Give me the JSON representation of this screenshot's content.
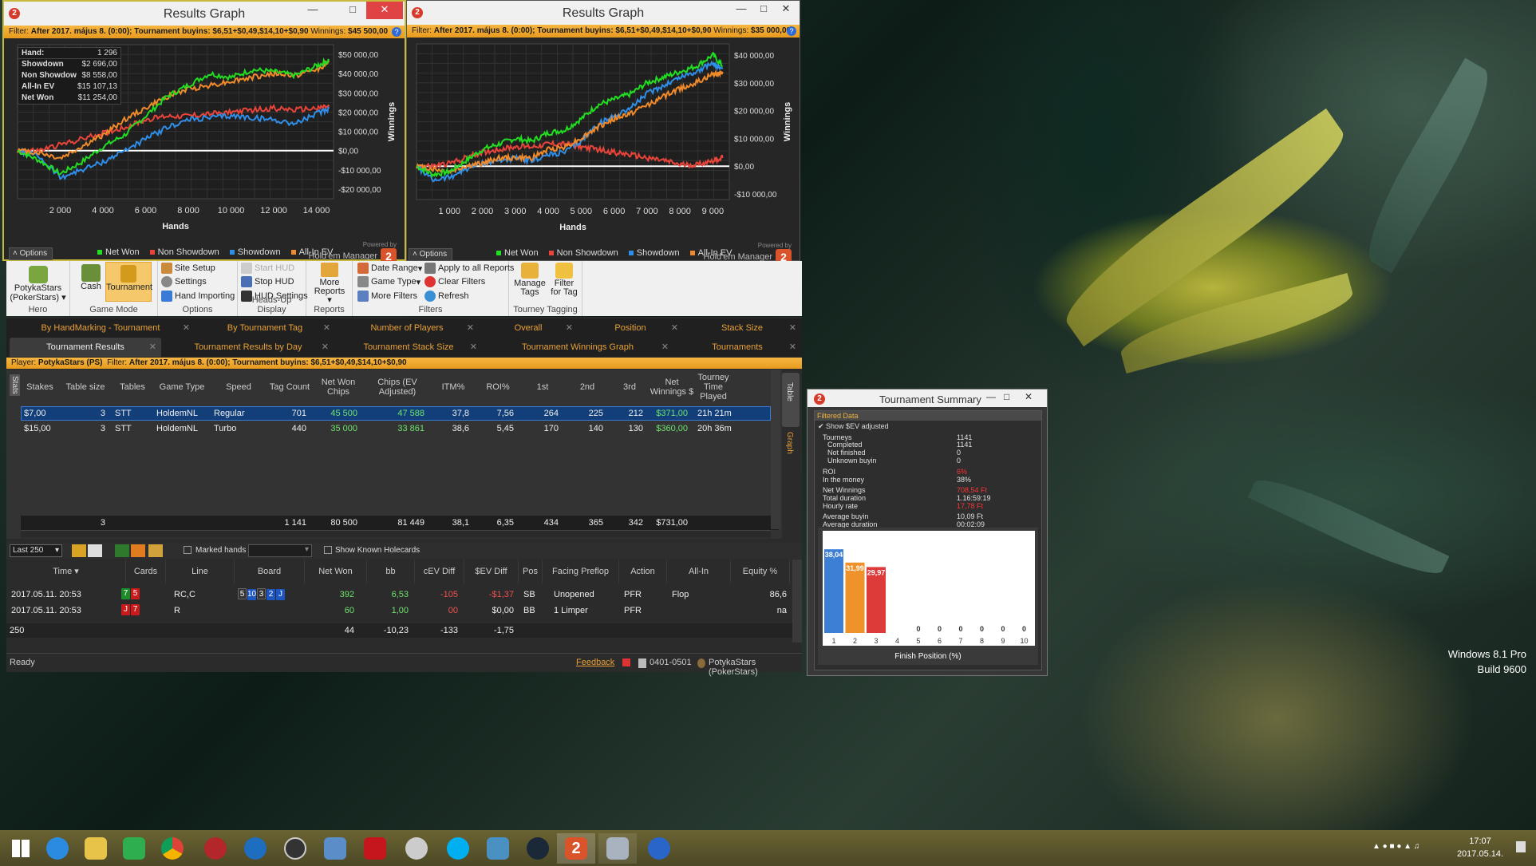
{
  "desktop": {
    "watermark_line1": "Windows 8.1 Pro",
    "watermark_line2": "Build 9600"
  },
  "graph1": {
    "title": "Results Graph",
    "filter_label": "Filter:",
    "filter_text": "After 2017. május 8. (0:00); Tournament buyins: $6,51+$0,49,$14,10+$0,90",
    "winnings_label": "Winnings:",
    "winnings_value": "$45 500,00",
    "stats": [
      {
        "k": "Hand:",
        "v": "1 296"
      },
      {
        "k": "Showdown",
        "v": "$2 696,00"
      },
      {
        "k": "Non Showdow",
        "v": "$8 558,00"
      },
      {
        "k": "All-In EV",
        "v": "$15 107,13"
      },
      {
        "k": "Net Won",
        "v": "$11 254,00"
      }
    ],
    "x_ticks": [
      "2 000",
      "4 000",
      "6 000",
      "8 000",
      "10 000",
      "12 000",
      "14 000"
    ],
    "y_ticks": [
      "$50 000,00",
      "$40 000,00",
      "$30 000,00",
      "$20 000,00",
      "$10 000,00",
      "$0,00",
      "-$10 000,00",
      "-$20 000,00"
    ],
    "xlabel": "Hands",
    "ylabel": "Winnings",
    "options": "Options",
    "legend": [
      "Net Won",
      "Non Showdown",
      "Showdown",
      "All-In EV"
    ],
    "powered": "Powered by",
    "brand": "Hold'em Manager",
    "badge": "2"
  },
  "graph2": {
    "title": "Results Graph",
    "filter_label": "Filter:",
    "filter_text": "After 2017. május 8. (0:00); Tournament buyins: $6,51+$0,49,$14,10+$0,90",
    "winnings_label": "Winnings:",
    "winnings_value": "$35 000,00",
    "x_ticks": [
      "1 000",
      "2 000",
      "3 000",
      "4 000",
      "5 000",
      "6 000",
      "7 000",
      "8 000",
      "9 000"
    ],
    "y_ticks": [
      "$40 000,00",
      "$30 000,00",
      "$20 000,00",
      "$10 000,00",
      "$0,00",
      "-$10 000,00"
    ],
    "xlabel": "Hands",
    "ylabel": "Winnings",
    "options": "Options",
    "legend": [
      "Net Won",
      "Non Showdown",
      "Showdown",
      "All-In EV"
    ],
    "powered": "Powered by",
    "brand": "Hold'em Manager",
    "badge": "2"
  },
  "colors": {
    "net_won": "#22dd22",
    "non_showdown": "#e8443a",
    "showdown": "#2f8ee8",
    "all_in_ev": "#f08a2a",
    "accent": "#e8a037"
  },
  "chart_data": [
    {
      "type": "line",
      "xlabel": "Hands",
      "ylabel": "Winnings",
      "xlim": [
        0,
        14800
      ],
      "ylim": [
        -25000,
        55000
      ],
      "x": [
        0,
        1000,
        2000,
        3000,
        4000,
        5000,
        6000,
        7000,
        8000,
        9000,
        10000,
        11000,
        12000,
        13000,
        14000,
        14600
      ],
      "series": [
        {
          "name": "Net Won",
          "values": [
            0,
            -5000,
            -12000,
            -6000,
            2000,
            8000,
            18000,
            28000,
            34000,
            40000,
            38000,
            42000,
            41000,
            39000,
            44000,
            47000
          ]
        },
        {
          "name": "Non Showdown",
          "values": [
            0,
            0,
            3000,
            6000,
            9000,
            12000,
            16000,
            18000,
            18000,
            19000,
            20000,
            21000,
            22000,
            21000,
            22000,
            23000
          ]
        },
        {
          "name": "Showdown",
          "values": [
            0,
            -3000,
            -14000,
            -10000,
            -6000,
            0,
            6000,
            12000,
            16000,
            17000,
            18000,
            17000,
            16000,
            14000,
            19000,
            22000
          ]
        },
        {
          "name": "All-In EV",
          "values": [
            0,
            -1000,
            -4000,
            2000,
            8000,
            16000,
            22000,
            28000,
            32000,
            34000,
            36000,
            38000,
            40000,
            39000,
            42000,
            46000
          ]
        }
      ]
    },
    {
      "type": "line",
      "xlabel": "Hands",
      "ylabel": "Winnings",
      "xlim": [
        0,
        9500
      ],
      "ylim": [
        -12000,
        44000
      ],
      "x": [
        0,
        500,
        1000,
        1500,
        2000,
        2500,
        3000,
        3500,
        4000,
        4500,
        5000,
        5500,
        6000,
        6500,
        7000,
        7500,
        8000,
        8500,
        9000,
        9300
      ],
      "series": [
        {
          "name": "Net Won",
          "values": [
            0,
            -3000,
            -2000,
            2000,
            6000,
            8000,
            10000,
            9000,
            12000,
            13000,
            17000,
            22000,
            24000,
            26000,
            30000,
            32000,
            34000,
            36000,
            40000,
            36000
          ]
        },
        {
          "name": "Non Showdown",
          "values": [
            0,
            0,
            1000,
            3000,
            5000,
            6000,
            7000,
            7000,
            8000,
            8000,
            7000,
            6000,
            5000,
            4000,
            3000,
            2000,
            500,
            500,
            2000,
            3000
          ]
        },
        {
          "name": "Showdown",
          "values": [
            0,
            -5000,
            -4000,
            -1000,
            1000,
            2000,
            3000,
            2000,
            4000,
            5000,
            9000,
            15000,
            18000,
            21000,
            26000,
            29000,
            32000,
            34000,
            37000,
            35000
          ]
        },
        {
          "name": "All-In EV",
          "values": [
            0,
            -1000,
            -2000,
            0,
            1000,
            3000,
            3000,
            3000,
            6000,
            7000,
            10000,
            14000,
            17000,
            19000,
            22000,
            25000,
            28000,
            30000,
            33000,
            34000
          ]
        }
      ]
    },
    {
      "type": "bar",
      "title": "Finish Position (%)",
      "categories": [
        "1",
        "2",
        "3",
        "4",
        "5",
        "6",
        "7",
        "8",
        "9",
        "10"
      ],
      "values": [
        38.04,
        31.99,
        29.97,
        0,
        0,
        0,
        0,
        0,
        0,
        0
      ],
      "value_labels": [
        "38,04",
        "31,99",
        "29,97",
        "",
        "0",
        "0",
        "0",
        "0",
        "0",
        "0"
      ],
      "ylim": [
        0,
        45
      ]
    }
  ],
  "ribbon": {
    "hero": {
      "name": "PotykaStars",
      "site": "(PokerStars)",
      "label": "Hero"
    },
    "gamemode": {
      "cash": "Cash",
      "tournament": "Tournament",
      "label": "Game Mode"
    },
    "options": {
      "site_setup": "Site Setup",
      "settings": "Settings",
      "hand_importing": "Hand Importing",
      "label": "Options"
    },
    "hud": {
      "start": "Start HUD",
      "stop": "Stop HUD",
      "settings": "HUD Settings",
      "label": "Heads-Up Display"
    },
    "reports": {
      "more": "More",
      "reports": "Reports",
      "label": "Reports"
    },
    "filters": {
      "date_range": "Date Range",
      "game_type": "Game Type",
      "more_filters": "More Filters",
      "apply_all": "Apply to all Reports",
      "clear": "Clear Filters",
      "refresh": "Refresh",
      "label": "Filters"
    },
    "tagging": {
      "manage": "Manage",
      "tags": "Tags",
      "filter": "Filter",
      "for_tag": "for Tag",
      "label": "Tourney Tagging"
    }
  },
  "tabs_row1": [
    "By HandMarking - Tournament",
    "By Tournament Tag",
    "Number of Players",
    "Overall",
    "Position",
    "Stack Size"
  ],
  "tabs_row2": [
    "Tournament Results",
    "Tournament Results by Day",
    "Tournament Stack Size",
    "Tournament Winnings Graph",
    "Tournaments"
  ],
  "player_bar": {
    "player_label": "Player:",
    "player": "PotykaStars (PS)",
    "filter_label": "Filter:",
    "filter": "After 2017. május 8. (0:00); Tournament buyins: $6,51+$0,49,$14,10+$0,90"
  },
  "results": {
    "side_label": "Stats",
    "headers": [
      "Stakes",
      "Table size",
      "Tables",
      "Game Type",
      "Speed",
      "Tag Count",
      "Net Won Chips",
      "Chips (EV Adjusted)",
      "ITM%",
      "ROI%",
      "1st",
      "2nd",
      "3rd",
      "Net Winnings $",
      "Tourney Time Played"
    ],
    "rows": [
      [
        "$7,00",
        "3",
        "STT",
        "HoldemNL",
        "Regular",
        "701",
        "45 500",
        "47 588",
        "37,8",
        "7,56",
        "264",
        "225",
        "212",
        "$371,00",
        "21h 21m"
      ],
      [
        "$15,00",
        "3",
        "STT",
        "HoldemNL",
        "Turbo",
        "440",
        "35 000",
        "33 861",
        "38,6",
        "5,45",
        "170",
        "140",
        "130",
        "$360,00",
        "20h 36m"
      ]
    ],
    "totals": [
      "3",
      "1 141",
      "80 500",
      "81 449",
      "38,1",
      "6,35",
      "434",
      "365",
      "342",
      "$731,00"
    ],
    "side_table": "Table",
    "side_graph": "Graph"
  },
  "handbar": {
    "last": "Last 250",
    "marked": "Marked hands",
    "known": "Show Known Holecards"
  },
  "hands": {
    "headers": [
      "Time",
      "Cards",
      "Line",
      "Board",
      "Net Won",
      "bb",
      "cEV Diff",
      "$EV Diff",
      "Pos",
      "Facing Preflop",
      "Action",
      "All-In",
      "Equity %"
    ],
    "rows": [
      {
        "time": "2017.05.11. 20:53",
        "cards": [
          "7",
          "5"
        ],
        "line": "RC,C",
        "board": [
          "5",
          "10",
          "3",
          "2",
          "J"
        ],
        "net": "392",
        "bb": "6,53",
        "cev": "-105",
        "sev": "-$1,37",
        "pos": "SB",
        "facing": "Unopened",
        "action": "PFR",
        "allin": "Flop",
        "eq": "86,6"
      },
      {
        "time": "2017.05.11. 20:53",
        "cards": [
          "J",
          "7"
        ],
        "line": "R",
        "board": [],
        "net": "60",
        "bb": "1,00",
        "cev": "00",
        "sev": "$0,00",
        "pos": "BB",
        "facing": "1 Limper",
        "action": "PFR",
        "allin": "",
        "eq": "na"
      }
    ],
    "totals": [
      "250",
      "44",
      "-10,23",
      "-133",
      "-1,75"
    ]
  },
  "status": {
    "ready": "Ready",
    "feedback": "Feedback",
    "build": "0401-0501",
    "user": "PotykaStars (PokerStars)"
  },
  "summary": {
    "title": "Tournament Summary",
    "filtered": "Filtered Data",
    "sev": "Show $EV adjusted",
    "rows": [
      {
        "k": "Tourneys",
        "v": "1141"
      },
      {
        "k": "Completed",
        "v": "1141"
      },
      {
        "k": "Not finished",
        "v": "0"
      },
      {
        "k": "Unknown buyin",
        "v": "0"
      },
      {
        "k": "ROI",
        "v": "6%"
      },
      {
        "k": "In the money",
        "v": "38%"
      },
      {
        "k": "Net Winnings",
        "v": "708,54 Ft"
      },
      {
        "k": "Total duration",
        "v": "1.16:59:19"
      },
      {
        "k": "Hourly rate",
        "v": "17,78 Ft"
      },
      {
        "k": "Average buyin",
        "v": "10,09 Ft"
      },
      {
        "k": "Average duration",
        "v": "00:02:09"
      }
    ],
    "xlabel": "Finish Position (%)"
  },
  "clock": {
    "time": "17:07",
    "date": "2017.05.14."
  }
}
